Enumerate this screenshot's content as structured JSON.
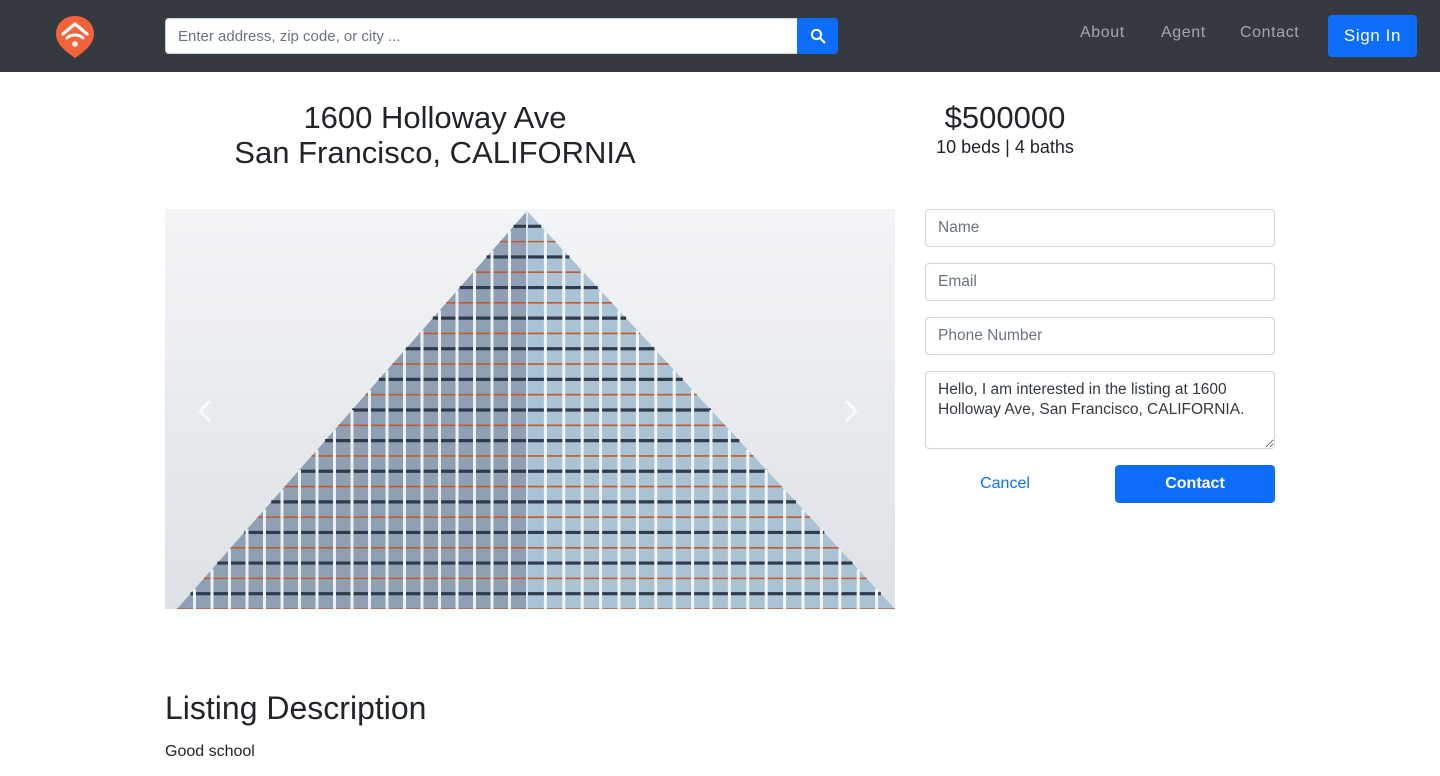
{
  "navbar": {
    "search": {
      "placeholder": "Enter address, zip code, or city ..."
    },
    "links": [
      "About",
      "Agent",
      "Contact"
    ],
    "signin_label": "Sign In",
    "logo_icon": "home-pin-logo-icon",
    "search_icon": "search-icon",
    "colors": {
      "bar": "#343a40",
      "accent": "#0d6efd",
      "logo": "#f4623a"
    }
  },
  "listing": {
    "address_line1": "1600 Holloway Ave",
    "address_line2": "San Francisco, CALIFORNIA",
    "price": "$500000",
    "specs": "10 beds | 4 baths"
  },
  "carousel": {
    "prev_icon": "chevron-left-icon",
    "next_icon": "chevron-right-icon"
  },
  "contact_form": {
    "name_placeholder": "Name",
    "email_placeholder": "Email",
    "phone_placeholder": "Phone Number",
    "message_value": "Hello, I am interested in the listing at 1600 Holloway Ave, San Francisco, CALIFORNIA.",
    "cancel_label": "Cancel",
    "contact_label": "Contact"
  },
  "description": {
    "title": "Listing Description",
    "text": "Good school"
  }
}
